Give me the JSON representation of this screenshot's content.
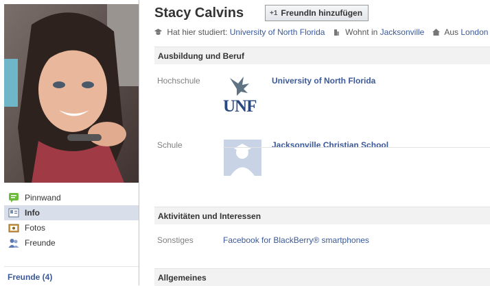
{
  "profile": {
    "name": "Stacy Calvins",
    "add_friend_label": "FreundIn hinzufügen"
  },
  "info_line": {
    "studied_prefix": "Hat hier studiert:",
    "studied_link": "University of North Florida",
    "lives_prefix": "Wohnt in",
    "lives_link": "Jacksonville",
    "from_prefix": "Aus",
    "from_link": "London"
  },
  "nav": {
    "items": [
      {
        "label": "Pinnwand",
        "icon": "wall-icon"
      },
      {
        "label": "Info",
        "icon": "info-icon"
      },
      {
        "label": "Fotos",
        "icon": "photos-icon"
      },
      {
        "label": "Freunde",
        "icon": "friends-icon"
      }
    ],
    "active": "Info",
    "friends_link": "Freunde (4)"
  },
  "sections": {
    "education": {
      "title": "Ausbildung und Beruf",
      "college_label": "Hochschule",
      "college_name": "University of North Florida",
      "college_logo_text": "UNF",
      "school_label": "Schule",
      "school_name": "Jacksonville Christian School"
    },
    "activities": {
      "title": "Aktivitäten und Interessen",
      "other_label": "Sonstiges",
      "other_value": "Facebook for BlackBerry® smartphones"
    },
    "general": {
      "title": "Allgemeines"
    }
  },
  "colors": {
    "link": "#3b5998",
    "nav_active_bg": "#d8dfea",
    "section_bg": "#f2f2f2",
    "label": "#808080"
  }
}
